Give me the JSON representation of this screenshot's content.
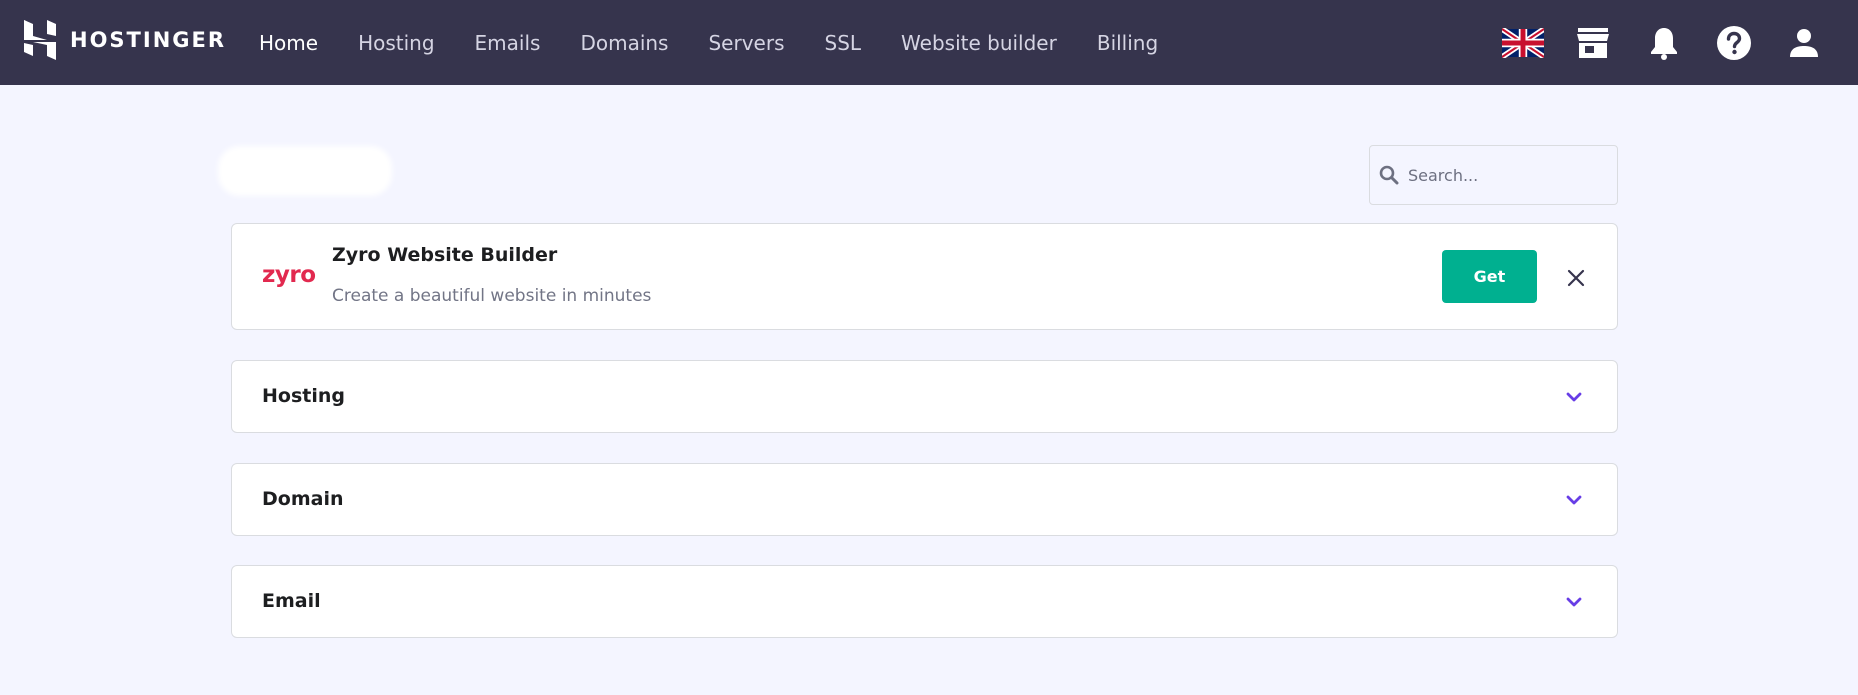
{
  "brand": {
    "name": "HOSTINGER"
  },
  "nav": {
    "items": [
      {
        "label": "Home",
        "active": true
      },
      {
        "label": "Hosting",
        "active": false
      },
      {
        "label": "Emails",
        "active": false
      },
      {
        "label": "Domains",
        "active": false
      },
      {
        "label": "Servers",
        "active": false
      },
      {
        "label": "SSL",
        "active": false
      },
      {
        "label": "Website builder",
        "active": false
      },
      {
        "label": "Billing",
        "active": false
      }
    ]
  },
  "top_icons": [
    "uk-flag-icon",
    "store-icon",
    "bell-icon",
    "help-icon",
    "user-icon"
  ],
  "search": {
    "placeholder": "Search..."
  },
  "promo": {
    "logo_text": "zyro",
    "title": "Zyro Website Builder",
    "subtitle": "Create a beautiful website in minutes",
    "cta_label": "Get"
  },
  "sections": [
    {
      "label": "Hosting"
    },
    {
      "label": "Domain"
    },
    {
      "label": "Email"
    }
  ],
  "colors": {
    "topbar": "#36344d",
    "background": "#f4f5ff",
    "accent_green": "#00b090",
    "zyro_pink": "#e2294f",
    "chevron": "#673de6"
  }
}
